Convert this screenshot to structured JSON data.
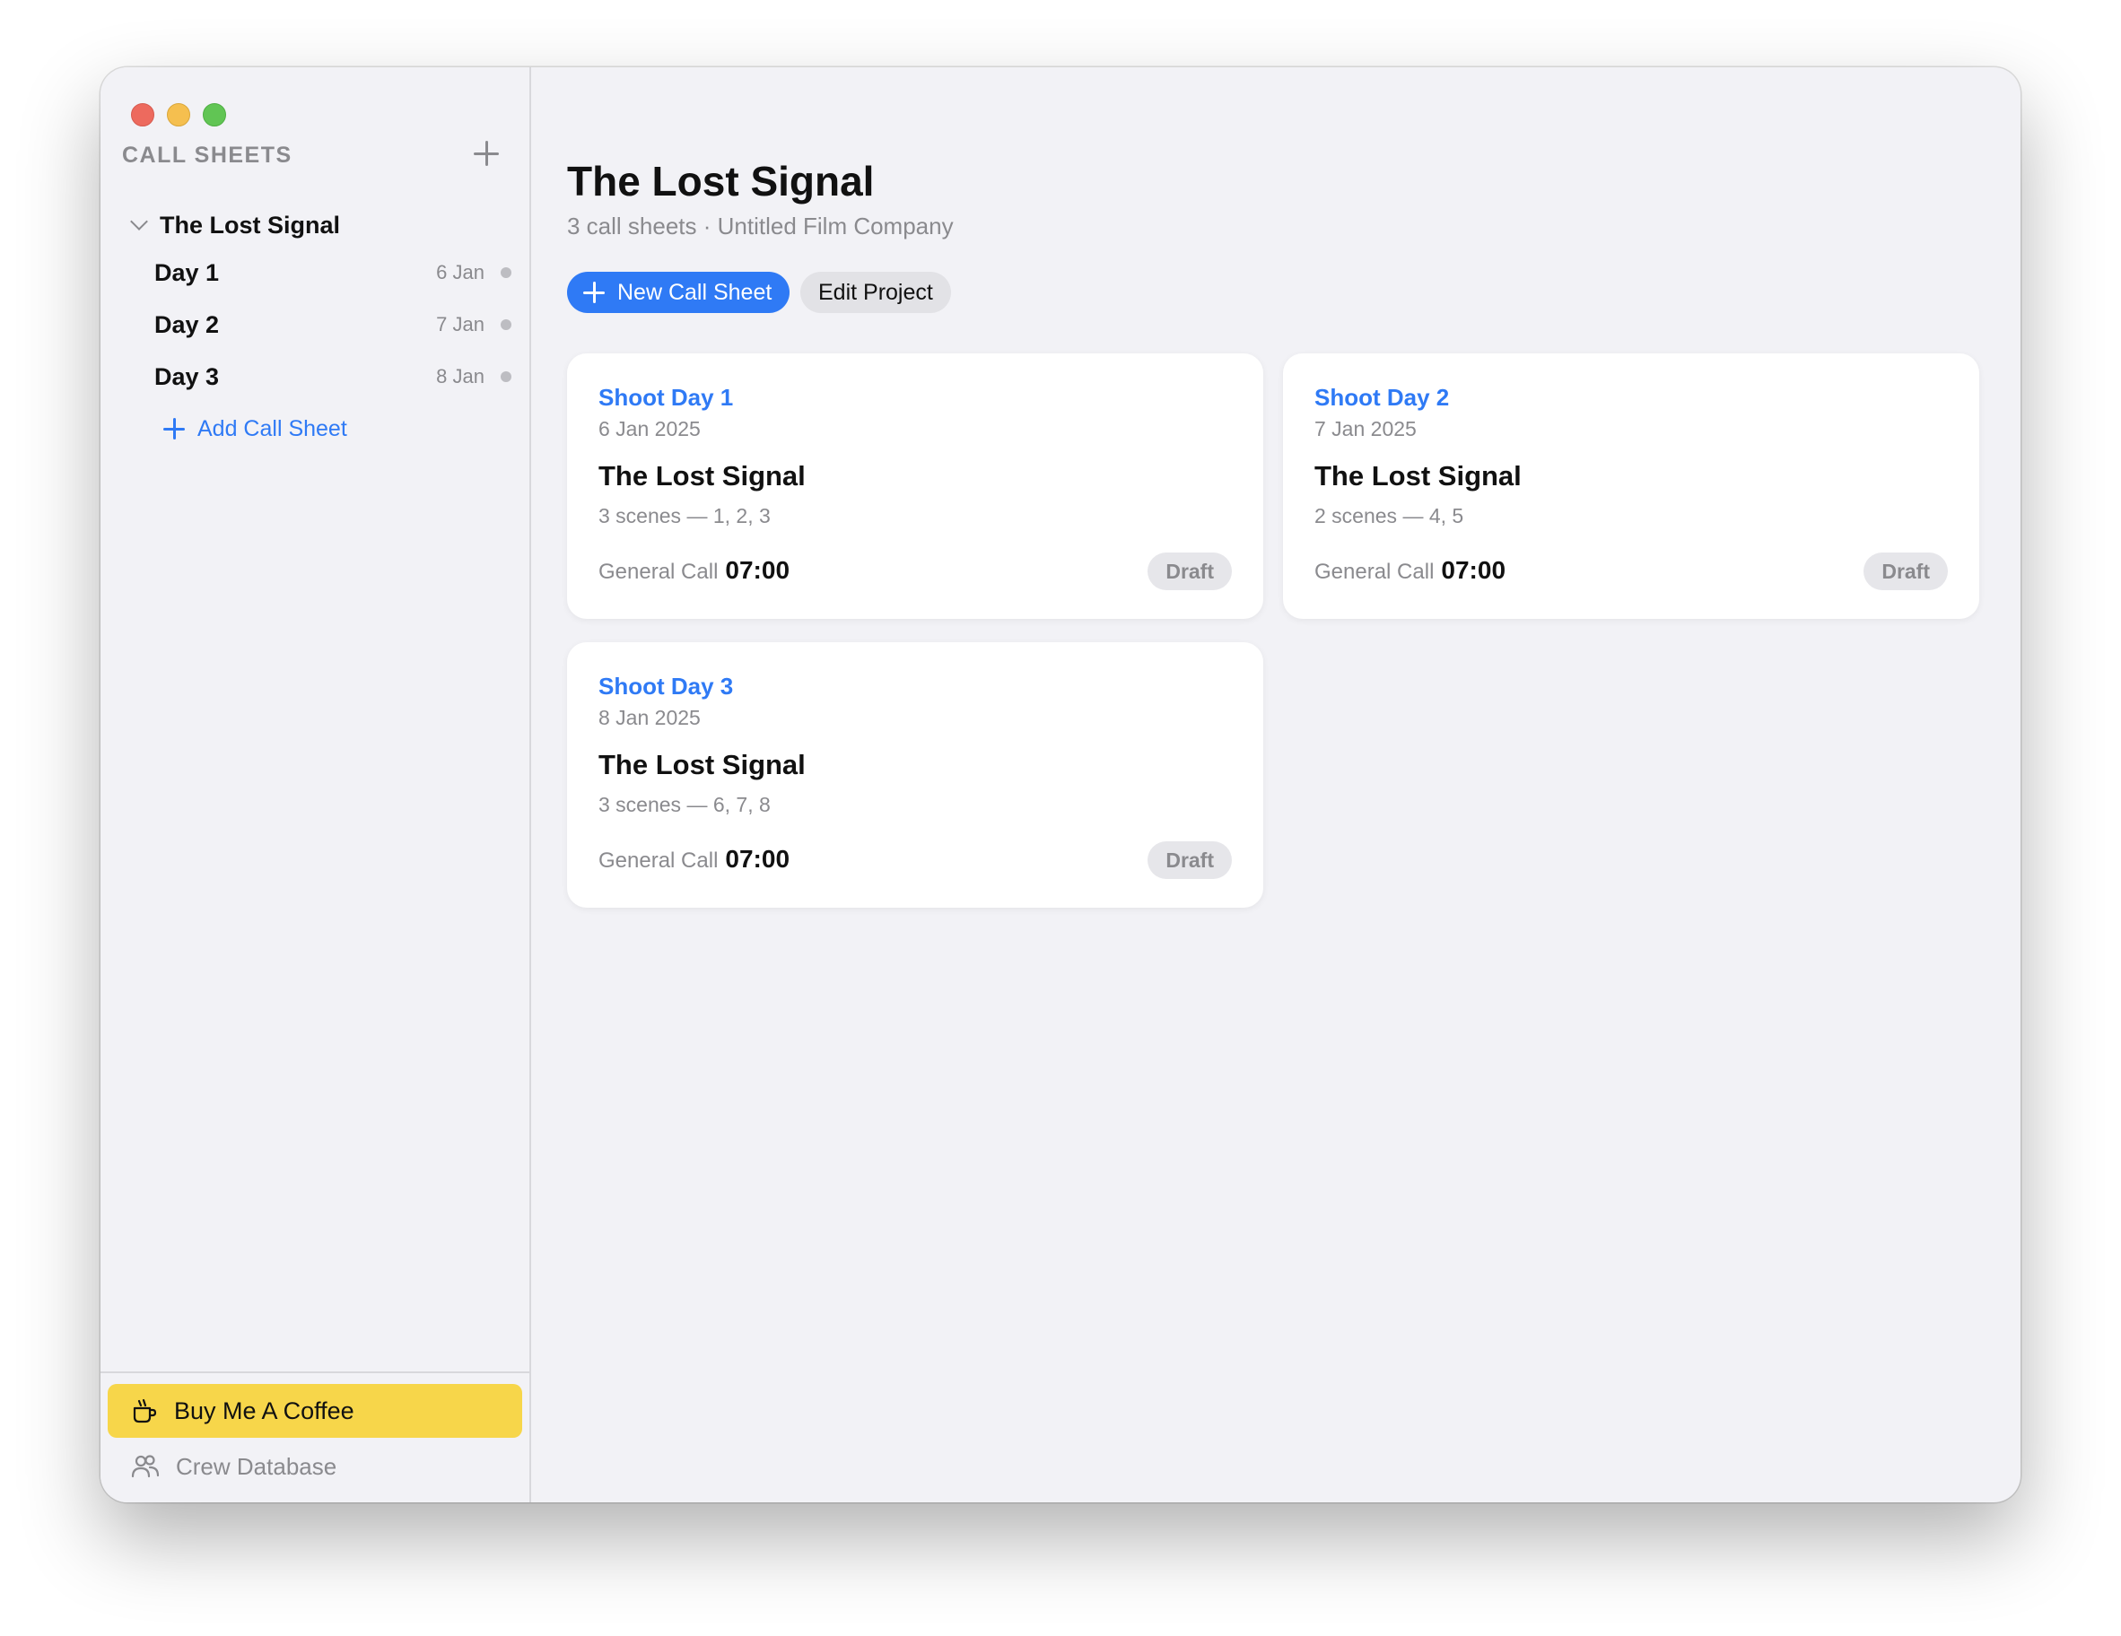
{
  "colors": {
    "accent": "#2f7af5",
    "coffee": "#f7d64a",
    "badge_bg": "#e6e6ea",
    "muted_text": "#8a8a8e"
  },
  "sidebar": {
    "header": "CALL SHEETS",
    "project": {
      "name": "The Lost Signal",
      "expanded": true
    },
    "days": [
      {
        "label": "Day 1",
        "date": "6 Jan"
      },
      {
        "label": "Day 2",
        "date": "7 Jan"
      },
      {
        "label": "Day 3",
        "date": "8 Jan"
      }
    ],
    "add_label": "Add Call Sheet",
    "footer": {
      "coffee_label": "Buy Me A Coffee",
      "crew_label": "Crew Database"
    }
  },
  "main": {
    "title": "The Lost Signal",
    "subtitle": "3 call sheets · Untitled Film Company",
    "new_button": "New Call Sheet",
    "edit_button": "Edit Project",
    "cards": [
      {
        "label": "Shoot Day 1",
        "date": "6 Jan 2025",
        "project": "The Lost Signal",
        "scenes": "3 scenes — 1, 2, 3",
        "call_label": "General Call",
        "call_time": "07:00",
        "status": "Draft"
      },
      {
        "label": "Shoot Day 2",
        "date": "7 Jan 2025",
        "project": "The Lost Signal",
        "scenes": "2 scenes — 4, 5",
        "call_label": "General Call",
        "call_time": "07:00",
        "status": "Draft"
      },
      {
        "label": "Shoot Day 3",
        "date": "8 Jan 2025",
        "project": "The Lost Signal",
        "scenes": "3 scenes — 6, 7, 8",
        "call_label": "General Call",
        "call_time": "07:00",
        "status": "Draft"
      }
    ]
  }
}
